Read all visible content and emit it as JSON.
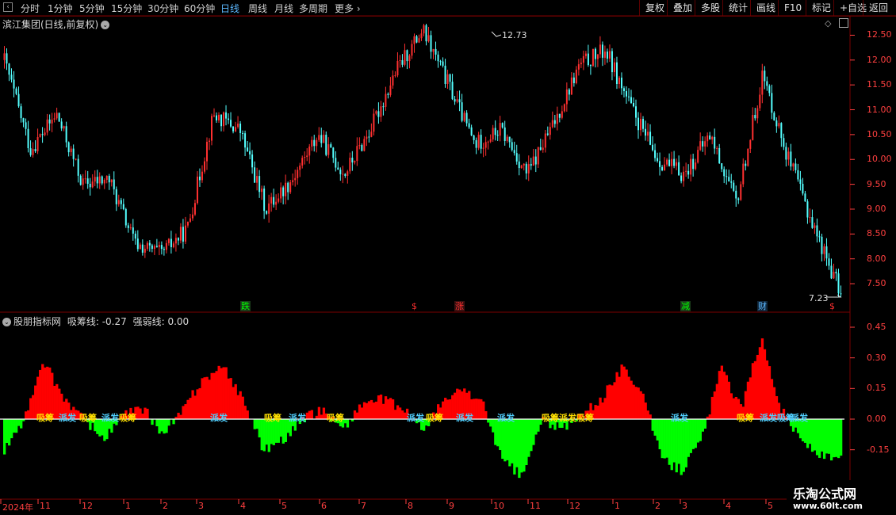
{
  "toolbar": {
    "periods": [
      "分时",
      "1分钟",
      "5分钟",
      "15分钟",
      "30分钟",
      "60分钟",
      "日线",
      "周线",
      "月线",
      "多周期",
      "更多"
    ],
    "active_period": "日线",
    "right_buttons": [
      "复权",
      "叠加",
      "多股",
      "统计",
      "画线",
      "F10",
      "标记",
      "+自选",
      "返回"
    ]
  },
  "main": {
    "title": "滨江集团(日线,前复权)",
    "high_label": "12.73",
    "low_label": "7.23",
    "price_axis": [
      "12.50",
      "12.00",
      "11.50",
      "11.00",
      "10.50",
      "10.00",
      "9.50",
      "9.00",
      "8.50",
      "8.00",
      "7.50"
    ],
    "signals": [
      {
        "text": "跌",
        "color": "#00ff00",
        "bg": "#1a3a1a"
      },
      {
        "text": "$",
        "color": "#ff3030",
        "bg": "transparent"
      },
      {
        "text": "涨",
        "color": "#ff3030",
        "bg": "#3a1010"
      },
      {
        "text": "减",
        "color": "#00ff00",
        "bg": "#1a3a1a"
      },
      {
        "text": "财",
        "color": "#5cb8ff",
        "bg": "#10263a"
      },
      {
        "text": "$",
        "color": "#ff3030",
        "bg": "transparent"
      }
    ]
  },
  "indicator": {
    "name": "股朋指标网",
    "line1_label": "吸筹线: -0.27",
    "line2_label": "强弱线: 0.00",
    "axis": [
      "0.45",
      "0.30",
      "0.15",
      "0.00",
      "-0.15"
    ],
    "tags": [
      "吸筹",
      "派发",
      "吸筹",
      "派发",
      "吸筹",
      "派发",
      "吸筹",
      "派发",
      "吸筹",
      "派发",
      "吸筹",
      "派发",
      "派发",
      "吸筹派发吸筹",
      "派发",
      "吸筹",
      "派发吸筹",
      "派发"
    ]
  },
  "dates": [
    "2024年",
    "11",
    "12",
    "1",
    "2",
    "3",
    "4",
    "5",
    "6",
    "7",
    "8",
    "9",
    "10",
    "11",
    "12",
    "1",
    "2",
    "3",
    "4",
    "5"
  ],
  "watermark": {
    "line1": "乐淘公式网",
    "line2": "www.60lt.com"
  },
  "colors": {
    "up": "#ff3030",
    "down": "#54ffff",
    "pos_bar": "#ff0000",
    "neg_bar": "#00ff00",
    "axis": "#ff4040",
    "grid": "#7a0000"
  },
  "chart_data": {
    "type": "candlestick",
    "price_axis_range": [
      7.23,
      12.73
    ],
    "price_trend_waypoints": [
      12.0,
      10.2,
      10.9,
      9.5,
      9.6,
      8.3,
      8.1,
      8.6,
      10.9,
      10.6,
      9.0,
      9.6,
      10.5,
      9.7,
      10.6,
      11.8,
      12.6,
      11.5,
      10.3,
      10.6,
      9.7,
      10.7,
      11.9,
      12.2,
      11.0,
      10.0,
      9.7,
      10.5,
      9.1,
      11.7,
      10.0,
      8.6,
      7.3
    ],
    "indicator_axis_range": [
      -0.2,
      0.5
    ],
    "indicator_trend_waypoints": [
      -0.15,
      0.0,
      0.28,
      0.1,
      0.0,
      -0.1,
      0.02,
      0.05,
      -0.08,
      0.05,
      0.2,
      0.25,
      0.1,
      -0.15,
      -0.1,
      0.0,
      0.05,
      -0.05,
      0.08,
      0.1,
      0.05,
      -0.05,
      0.08,
      0.15,
      0.08,
      -0.2,
      -0.28,
      0.0,
      -0.05,
      0.02,
      0.1,
      0.25,
      0.15,
      -0.2,
      -0.25,
      -0.1,
      0.25,
      0.05,
      0.4,
      0.05,
      -0.1,
      -0.18,
      -0.2
    ]
  }
}
